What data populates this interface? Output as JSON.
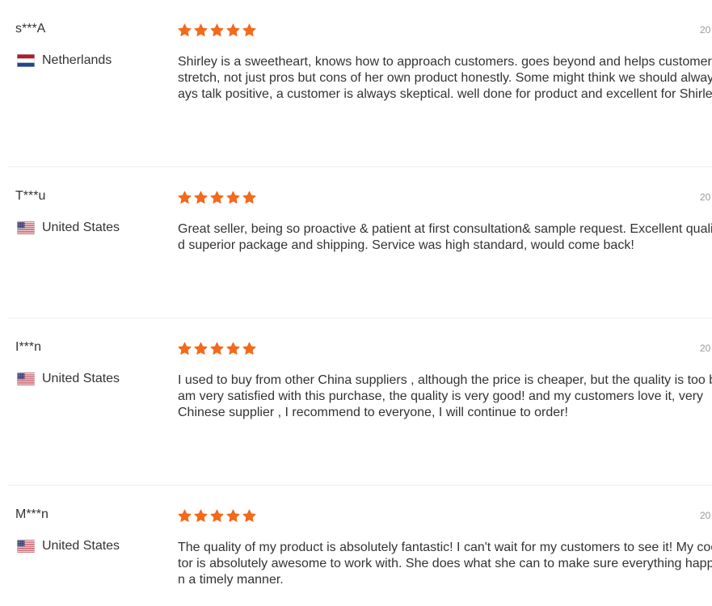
{
  "colors": {
    "star": "#f26a1b",
    "text": "#333333",
    "muted": "#999999",
    "divider": "#eeeeee"
  },
  "reviews": [
    {
      "buyer": "s***A",
      "country": "Netherlands",
      "flag_icon": "netherlands-flag-icon",
      "rating": 5,
      "date": "20",
      "lines": [
        "Shirley is a sweetheart, knows how to approach customers. goes beyond and helps customer",
        "stretch, not just pros but cons of her own product honestly. Some might think we should alway",
        "ays talk positive, a customer is always skeptical. well done for product and excellent for Shirle"
      ]
    },
    {
      "buyer": "T***u",
      "country": "United States",
      "flag_icon": "usa-flag-icon",
      "rating": 5,
      "date": "20",
      "lines": [
        "Great seller, being so proactive & patient at first consultation& sample request. Excellent quali",
        "d superior package and shipping. Service was high standard, would come back!"
      ]
    },
    {
      "buyer": "I***n",
      "country": "United States",
      "flag_icon": "usa-flag-icon",
      "rating": 5,
      "date": "20",
      "lines": [
        "I used to buy from other China suppliers , although the price is cheaper, but the quality is too b",
        "am very satisfied with this purchase, the quality is very good!   and my customers love it, very",
        "Chinese supplier , I recommend to everyone, I will continue to order!"
      ]
    },
    {
      "buyer": "M***n",
      "country": "United States",
      "flag_icon": "usa-flag-icon",
      "rating": 5,
      "date": "20",
      "lines": [
        "The quality of my product is absolutely fantastic! I can't wait for my customers to see it! My coo",
        "tor is absolutely awesome to work with. She does what she can to make sure everything happ",
        "n a timely manner."
      ]
    }
  ]
}
